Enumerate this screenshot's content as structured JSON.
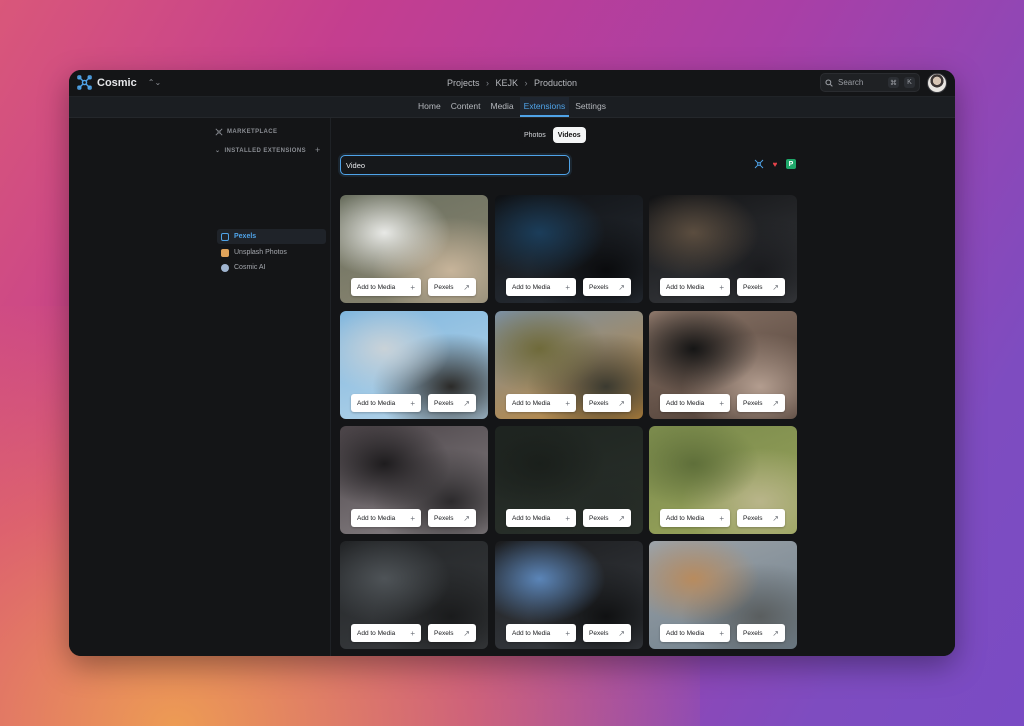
{
  "app": {
    "name": "Cosmic",
    "switch_glyph": "⌃⌄"
  },
  "breadcrumb": [
    "Projects",
    "KEJK",
    "Production"
  ],
  "search": {
    "label": "Search",
    "keys": [
      "⌘",
      "K"
    ]
  },
  "nav": {
    "items": [
      "Home",
      "Content",
      "Media",
      "Extensions",
      "Settings"
    ],
    "active": "Extensions"
  },
  "sidebar": {
    "marketplace_label": "MARKETPLACE",
    "installed_label": "INSTALLED EXTENSIONS",
    "items": [
      {
        "label": "Pexels",
        "icon": "pexels-icon",
        "color": "#4fa3e8",
        "active": true
      },
      {
        "label": "Unsplash Photos",
        "icon": "unsplash-icon",
        "color": "#e0a35a",
        "active": false
      },
      {
        "label": "Cosmic AI",
        "icon": "cosmic-ai-icon",
        "color": "#9fb4cf",
        "active": false
      }
    ]
  },
  "media_tabs": {
    "items": [
      "Photos",
      "Videos"
    ],
    "active": "Videos"
  },
  "query": {
    "value": "Video"
  },
  "tool_icons": [
    "cosmic-icon",
    "heart-icon",
    "pexels-icon"
  ],
  "card_buttons": {
    "add": "Add to Media",
    "add_glyph": "+",
    "source": "Pexels",
    "source_glyph": "↗"
  },
  "results": [
    {
      "subject": "beach-waves",
      "colors": [
        "#6a6f5f",
        "#8c8772",
        "#e8e9e6",
        "#c7b49a"
      ]
    },
    {
      "subject": "video-editing-desk",
      "colors": [
        "#0f1114",
        "#2a3038",
        "#1b3d5a",
        "#0a0b0d"
      ]
    },
    {
      "subject": "editing-timeline-monitor",
      "colors": [
        "#121315",
        "#3a3c40",
        "#5b4d3f",
        "#1a1b1e"
      ]
    },
    {
      "subject": "heart-palm-beach",
      "colors": [
        "#7fb6de",
        "#b8d6ea",
        "#c9d2d8",
        "#2b2a28"
      ]
    },
    {
      "subject": "autumn-tree",
      "colors": [
        "#7b8fa1",
        "#c2893a",
        "#6f6a3a",
        "#3b3a30"
      ]
    },
    {
      "subject": "camera-photographer",
      "colors": [
        "#8a7568",
        "#4a3a32",
        "#151515",
        "#b39d8f"
      ]
    },
    {
      "subject": "film-camera-rig",
      "colors": [
        "#4a4347",
        "#8b8588",
        "#1e1c1e",
        "#2c2a2c"
      ]
    },
    {
      "subject": "dark-forest-aerial",
      "colors": [
        "#1e2420",
        "#2a312b",
        "#1a1f1b",
        "#242a25"
      ]
    },
    {
      "subject": "farm-field-tractor",
      "colors": [
        "#7a8a4c",
        "#9aa55c",
        "#5f6f3a",
        "#b9b58a"
      ]
    },
    {
      "subject": "broadcast-camera",
      "colors": [
        "#222426",
        "#3a3d40",
        "#4e5357",
        "#1a1b1c"
      ]
    },
    {
      "subject": "control-room-monitors",
      "colors": [
        "#1b1c1e",
        "#3a3e44",
        "#5b85b8",
        "#101112"
      ]
    },
    {
      "subject": "beach-umbrellas",
      "colors": [
        "#9da3a8",
        "#6e7f8c",
        "#b88b5e",
        "#5a5e5f"
      ]
    }
  ]
}
